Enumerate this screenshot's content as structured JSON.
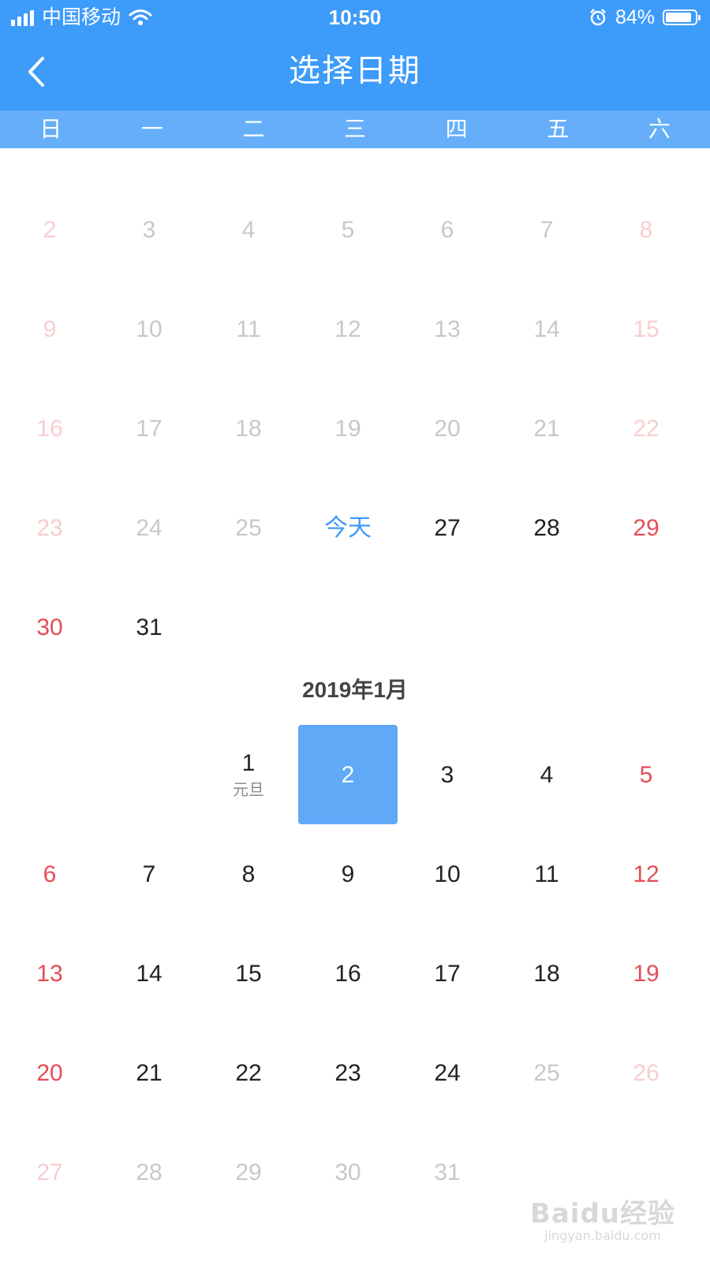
{
  "status_bar": {
    "carrier": "中国移动",
    "time": "10:50",
    "battery": "84%"
  },
  "nav": {
    "title": "选择日期"
  },
  "weekdays": [
    "日",
    "一",
    "二",
    "三",
    "四",
    "五",
    "六"
  ],
  "months": [
    {
      "title": "",
      "start_weekday": 0,
      "first_row_index": 0,
      "rows": [
        [
          "2",
          "3",
          "4",
          "5",
          "6",
          "7",
          "8"
        ],
        [
          "9",
          "10",
          "11",
          "12",
          "13",
          "14",
          "15"
        ],
        [
          "16",
          "17",
          "18",
          "19",
          "20",
          "21",
          "22"
        ],
        [
          "23",
          "24",
          "25",
          "今天",
          "27",
          "28",
          "29"
        ],
        [
          "30",
          "31",
          "",
          "",
          "",
          "",
          ""
        ]
      ],
      "states": [
        [
          "past",
          "past",
          "past",
          "past",
          "past",
          "past",
          "past"
        ],
        [
          "past",
          "past",
          "past",
          "past",
          "past",
          "past",
          "past"
        ],
        [
          "past",
          "past",
          "past",
          "past",
          "past",
          "past",
          "past"
        ],
        [
          "past",
          "past",
          "past",
          "today",
          "active",
          "active",
          "active"
        ],
        [
          "active",
          "active",
          "",
          "",
          "",
          "",
          ""
        ]
      ]
    },
    {
      "title": "2019年1月",
      "rows": [
        [
          "",
          "",
          "1",
          "2",
          "3",
          "4",
          "5"
        ],
        [
          "6",
          "7",
          "8",
          "9",
          "10",
          "11",
          "12"
        ],
        [
          "13",
          "14",
          "15",
          "16",
          "17",
          "18",
          "19"
        ],
        [
          "20",
          "21",
          "22",
          "23",
          "24",
          "25",
          "26"
        ],
        [
          "27",
          "28",
          "29",
          "30",
          "31",
          "",
          ""
        ]
      ],
      "states": [
        [
          "",
          "",
          "active",
          "selected",
          "active",
          "active",
          "active"
        ],
        [
          "active",
          "active",
          "active",
          "active",
          "active",
          "active",
          "active"
        ],
        [
          "active",
          "active",
          "active",
          "active",
          "active",
          "active",
          "active"
        ],
        [
          "active",
          "active",
          "active",
          "active",
          "active",
          "past",
          "past"
        ],
        [
          "past",
          "past",
          "past",
          "past",
          "past",
          "",
          ""
        ]
      ],
      "subs": {
        "0-2": "元旦"
      }
    }
  ],
  "watermark": {
    "logo": "Baidu经验",
    "url": "jingyan.baidu.com"
  },
  "colors": {
    "primary": "#3d9bfa",
    "weekday_bar": "#66aefa",
    "selected": "#5fa9f6",
    "weekend": "#e54d57",
    "past": "#c8c8c8"
  }
}
